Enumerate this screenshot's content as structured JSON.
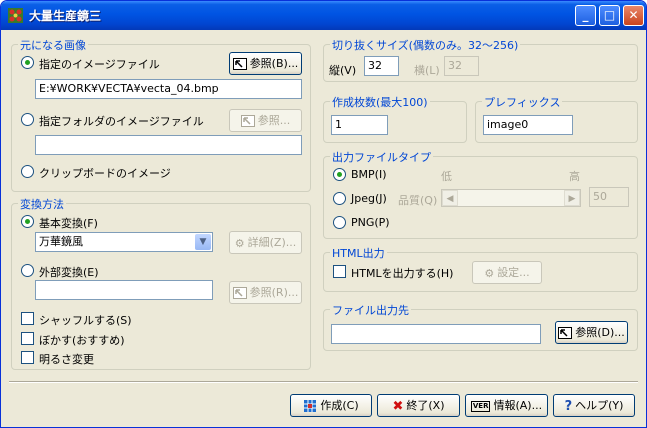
{
  "window": {
    "title": "大量生産鏡三",
    "minimize": "_",
    "maximize": "□",
    "close": "✕"
  },
  "source": {
    "group_title": "元になる画像",
    "file_radio": "指定のイメージファイル",
    "file_browse": "参照(B)...",
    "file_path": "E:¥WORK¥VECTA¥vecta_04.bmp",
    "folder_radio": "指定フォルダのイメージファイル",
    "folder_browse": "参照...",
    "folder_path": "",
    "clipboard_radio": "クリップボードのイメージ"
  },
  "convert": {
    "group_title": "変換方法",
    "basic_radio": "基本変換(F)",
    "basic_select": "万華鏡風",
    "detail_button": "詳細(Z)...",
    "external_radio": "外部変換(E)",
    "external_path": "",
    "external_browse": "参照(R)...",
    "shuffle": "シャッフルする(S)",
    "blur": "ぼかす(おすすめ)",
    "brightness": "明るさ変更"
  },
  "size": {
    "group_title": "切り抜くサイズ(偶数のみ。32〜256)",
    "height_label": "縦(V)",
    "height_value": "32",
    "width_label": "横(L)",
    "width_value": "32"
  },
  "count": {
    "group_title": "作成枚数(最大100)",
    "value": "1"
  },
  "prefix": {
    "group_title": "プレフィックス",
    "value": "image0"
  },
  "filetype": {
    "group_title": "出力ファイルタイプ",
    "bmp": "BMP(I)",
    "jpeg": "Jpeg(J)",
    "quality": "品質(Q)",
    "low": "低",
    "high": "高",
    "quality_value": "50",
    "png": "PNG(P)",
    "quality_level": 0.5
  },
  "html": {
    "group_title": "HTML出力",
    "checkbox": "HTMLを出力する(H)",
    "settings": "設定..."
  },
  "output": {
    "group_title": "ファイル出力先",
    "path": "",
    "browse": "参照(D)..."
  },
  "footer": {
    "create": "作成(C)",
    "exit": "終了(X)",
    "info": "情報(A)...",
    "help": "ヘルプ(Y)",
    "info_icon_text": "VER"
  },
  "colors": {
    "title_bar": "#0054e3",
    "group_title": "#0046d5",
    "radio_dot": "#21a121"
  }
}
